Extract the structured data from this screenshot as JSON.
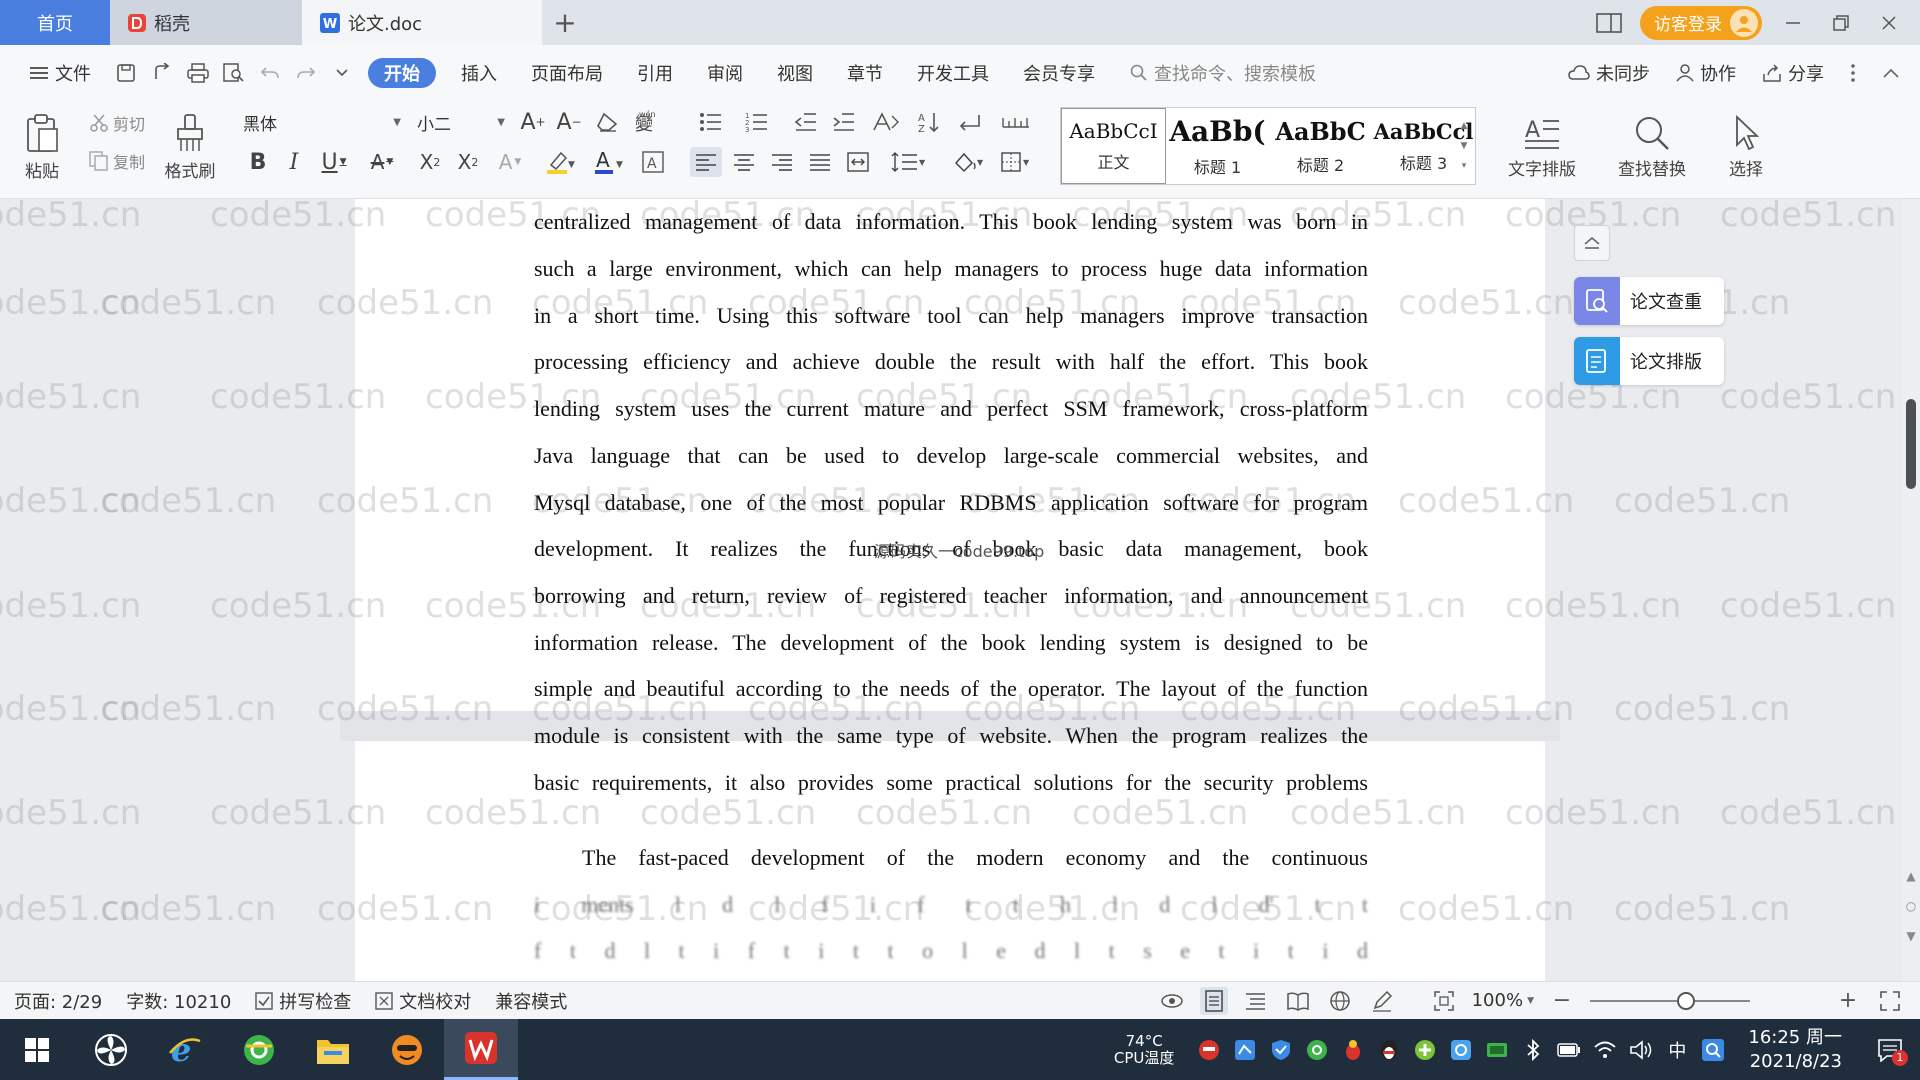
{
  "titlebar": {
    "tabs": [
      {
        "label": "首页"
      },
      {
        "label": "稻壳"
      },
      {
        "label": "论文.doc"
      }
    ],
    "login_label": "访客登录"
  },
  "menubar": {
    "file_label": "文件",
    "items": [
      "开始",
      "插入",
      "页面布局",
      "引用",
      "审阅",
      "视图",
      "章节",
      "开发工具",
      "会员专享"
    ],
    "search_placeholder": "查找命令、搜索模板",
    "sync_label": "未同步",
    "collab_label": "协作",
    "share_label": "分享"
  },
  "ribbon": {
    "paste_label": "粘贴",
    "cut_label": "剪切",
    "copy_label": "复制",
    "format_painter_label": "格式刷",
    "font_name": "黑体",
    "font_size": "小二",
    "styles": [
      {
        "sample": "AaBbCcI",
        "name": "正文"
      },
      {
        "sample": "AaBb(",
        "name": "标题 1"
      },
      {
        "sample": "AaBbC",
        "name": "标题 2"
      },
      {
        "sample": "AaBbCcl",
        "name": "标题 3"
      }
    ],
    "text_layout_label": "文字排版",
    "find_replace_label": "查找替换",
    "select_label": "选择"
  },
  "document": {
    "page1_lines": [
      "centralized management of data information. This book lending system was born in",
      "such a large environment, which can help managers to process huge data information",
      "in a short time. Using this software tool can help managers improve transaction",
      "processing efficiency and achieve double the result with half the effort. This book",
      "lending system uses the current mature and perfect SSM framework, cross-platform",
      "Java language that can be used to develop large-scale commercial websites, and",
      "Mysql database, one of the most popular RDBMS application software for program"
    ],
    "page2_lines": [
      "development. It realizes the functions of book basic data management, book",
      "borrowing and return, review of registered teacher information, and announcement",
      "information release. The development of the book lending system is designed to be",
      "simple and beautiful according to the needs of the operator. The layout of the function",
      "module is consistent with the same type of website. When the program realizes the",
      "basic requirements, it also provides some practical solutions for the security problems"
    ],
    "page2_para2_lines": [
      "The fast-paced development of the modern economy and the continuous",
      "i                       ments                 l    d    l              f  i    f                 t           t       h     l           d      l  d'   t          t",
      "      f                t    d  l    t  i       f               t    i           t    t     o       l    e          d     l   t       s      e       t         i    t         i     d"
    ],
    "overlay_caption": "源码实久一code99.top",
    "watermark_text": "code51.cn"
  },
  "side_panel": {
    "check_label": "论文查重",
    "layout_label": "论文排版"
  },
  "statusbar": {
    "page": "页面: 2/29",
    "words": "字数: 10210",
    "spellcheck": "拼写检查",
    "proofread": "文档校对",
    "compat": "兼容模式",
    "zoom": "100%",
    "zoom_level": 0.6
  },
  "taskbar": {
    "cpu_temp": "74°C",
    "cpu_label": "CPU温度",
    "ime": "中",
    "time": "16:25 周一",
    "date": "2021/8/23",
    "notify_count": "1"
  },
  "colors": {
    "accent": "#4a7fe0",
    "login": "#f4a21c",
    "taskbar": "#1f2d3d"
  }
}
